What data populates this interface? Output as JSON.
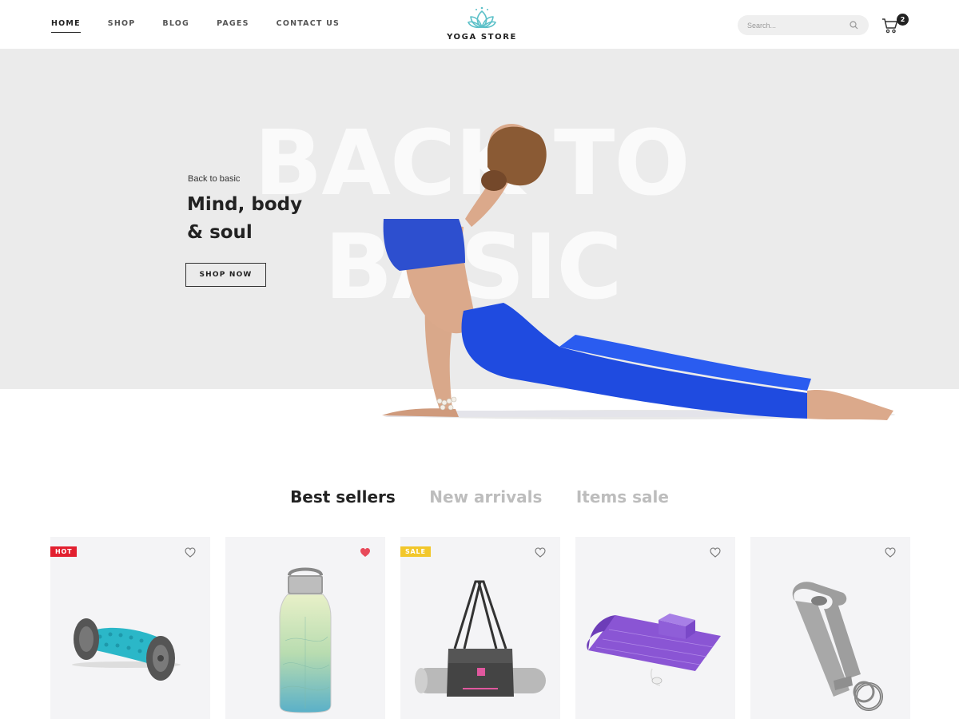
{
  "header": {
    "nav": [
      "HOME",
      "SHOP",
      "BLOG",
      "PAGES",
      "CONTACT US"
    ],
    "logo_text": "YOGA STORE",
    "search_placeholder": "Search...",
    "cart_count": "2"
  },
  "hero": {
    "bg_line1": "BACK TO",
    "bg_line2": "BASIC",
    "kicker": "Back to basic",
    "title_line1": "Mind, body",
    "title_line2": "& soul",
    "button": "SHOP NOW"
  },
  "tabs": [
    "Best sellers",
    "New arrivals",
    "Items sale"
  ],
  "products": [
    {
      "badge": "HOT",
      "heart": "outline-heart-icon",
      "image": "foam-roller-image"
    },
    {
      "badge": "",
      "heart": "filled-heart-icon",
      "image": "water-bottle-image"
    },
    {
      "badge": "SALE",
      "heart": "outline-heart-icon",
      "image": "yoga-mat-bag-image"
    },
    {
      "badge": "",
      "heart": "outline-heart-icon",
      "image": "purple-mat-image"
    },
    {
      "badge": "",
      "heart": "outline-heart-icon",
      "image": "yoga-strap-image"
    }
  ],
  "colors": {
    "accent": "#5bc0c8",
    "hot": "#e2202f",
    "sale": "#f2c72b",
    "heart_filled": "#e84a5a"
  }
}
